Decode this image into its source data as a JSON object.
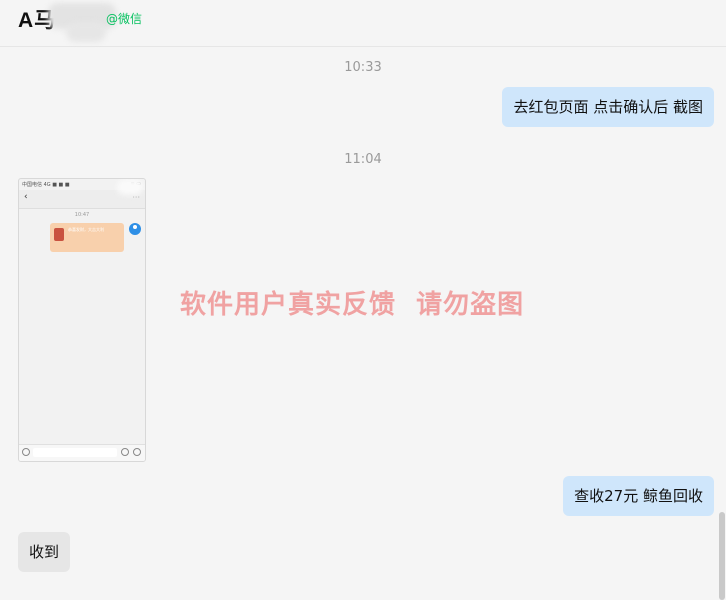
{
  "header": {
    "contact_name": "A马",
    "source_tag": "@微信"
  },
  "messages": [
    {
      "type": "timestamp",
      "text": "10:33"
    },
    {
      "type": "text",
      "side": "right",
      "text": "去红包页面 点击确认后 截图"
    },
    {
      "type": "timestamp",
      "text": "11:04"
    },
    {
      "type": "image",
      "side": "left",
      "inner": {
        "status_left": "中国电信 4G ■ ■ ■",
        "status_right": "≋ ▭",
        "time": "10:47",
        "redpacket_text": "恭喜发财，大吉大利"
      }
    },
    {
      "type": "text",
      "side": "right",
      "text": "查收27元 鲸鱼回收"
    },
    {
      "type": "text",
      "side": "left",
      "text": "收到"
    }
  ],
  "watermark": "软件用户真实反馈  请勿盗图"
}
